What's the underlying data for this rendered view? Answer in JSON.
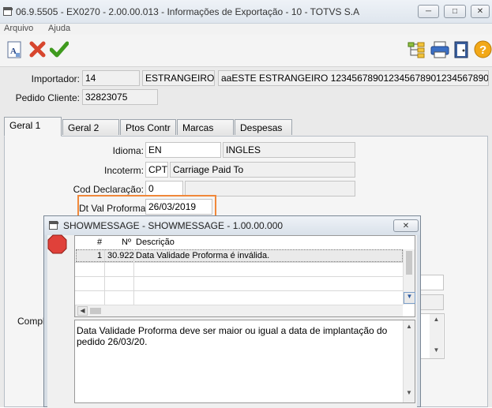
{
  "window": {
    "title": "06.9.5505 - EX0270 - 2.00.00.013 - Informações de Exportação - 10 - TOTVS S.A"
  },
  "menu": {
    "items": [
      "Arquivo",
      "Ajuda"
    ]
  },
  "header": {
    "importador_label": "Importador:",
    "importador_code": "14",
    "importador_type": "ESTRANGEIRO",
    "importador_name": "aaESTE ESTRANGEIRO 123456789012345678901234567890123456789",
    "pedido_label": "Pedido Cliente:",
    "pedido_value": "32823075"
  },
  "tabs": [
    "Geral 1",
    "Geral 2",
    "Ptos Contr",
    "Marcas",
    "Despesas"
  ],
  "geral1": {
    "idioma_label": "Idioma:",
    "idioma_code": "EN",
    "idioma_desc": "INGLES",
    "incoterm_label": "Incoterm:",
    "incoterm_code": "CPT",
    "incoterm_desc": "Carriage Paid To",
    "cod_declaracao_label": "Cod Declaração:",
    "cod_declaracao_value": "0",
    "dt_val_proforma_label": "Dt Val Proforma:",
    "dt_val_proforma_value": "26/03/2019",
    "comple_label": "Comple"
  },
  "dialog": {
    "title": "SHOWMESSAGE - SHOWMESSAGE - 1.00.00.000",
    "columns": [
      "#",
      "Nº",
      "Descrição"
    ],
    "rows": [
      {
        "num": "1",
        "code": "30.922",
        "desc": "Data Validade Proforma é inválida."
      }
    ],
    "message": "Data Validade Proforma deve ser maior ou igual a data de implantação do pedido 26/03/20."
  },
  "colors": {
    "highlight": "#f0883a",
    "title_gradient": "#dfe6ee",
    "error_stop": "#e0413a"
  },
  "icons": [
    "app-icon",
    "minimize-icon",
    "maximize-icon",
    "close-icon",
    "document-icon",
    "cancel-x-icon",
    "confirm-check-icon",
    "tree-icon",
    "print-icon",
    "exit-door-icon",
    "help-icon",
    "stop-icon"
  ]
}
